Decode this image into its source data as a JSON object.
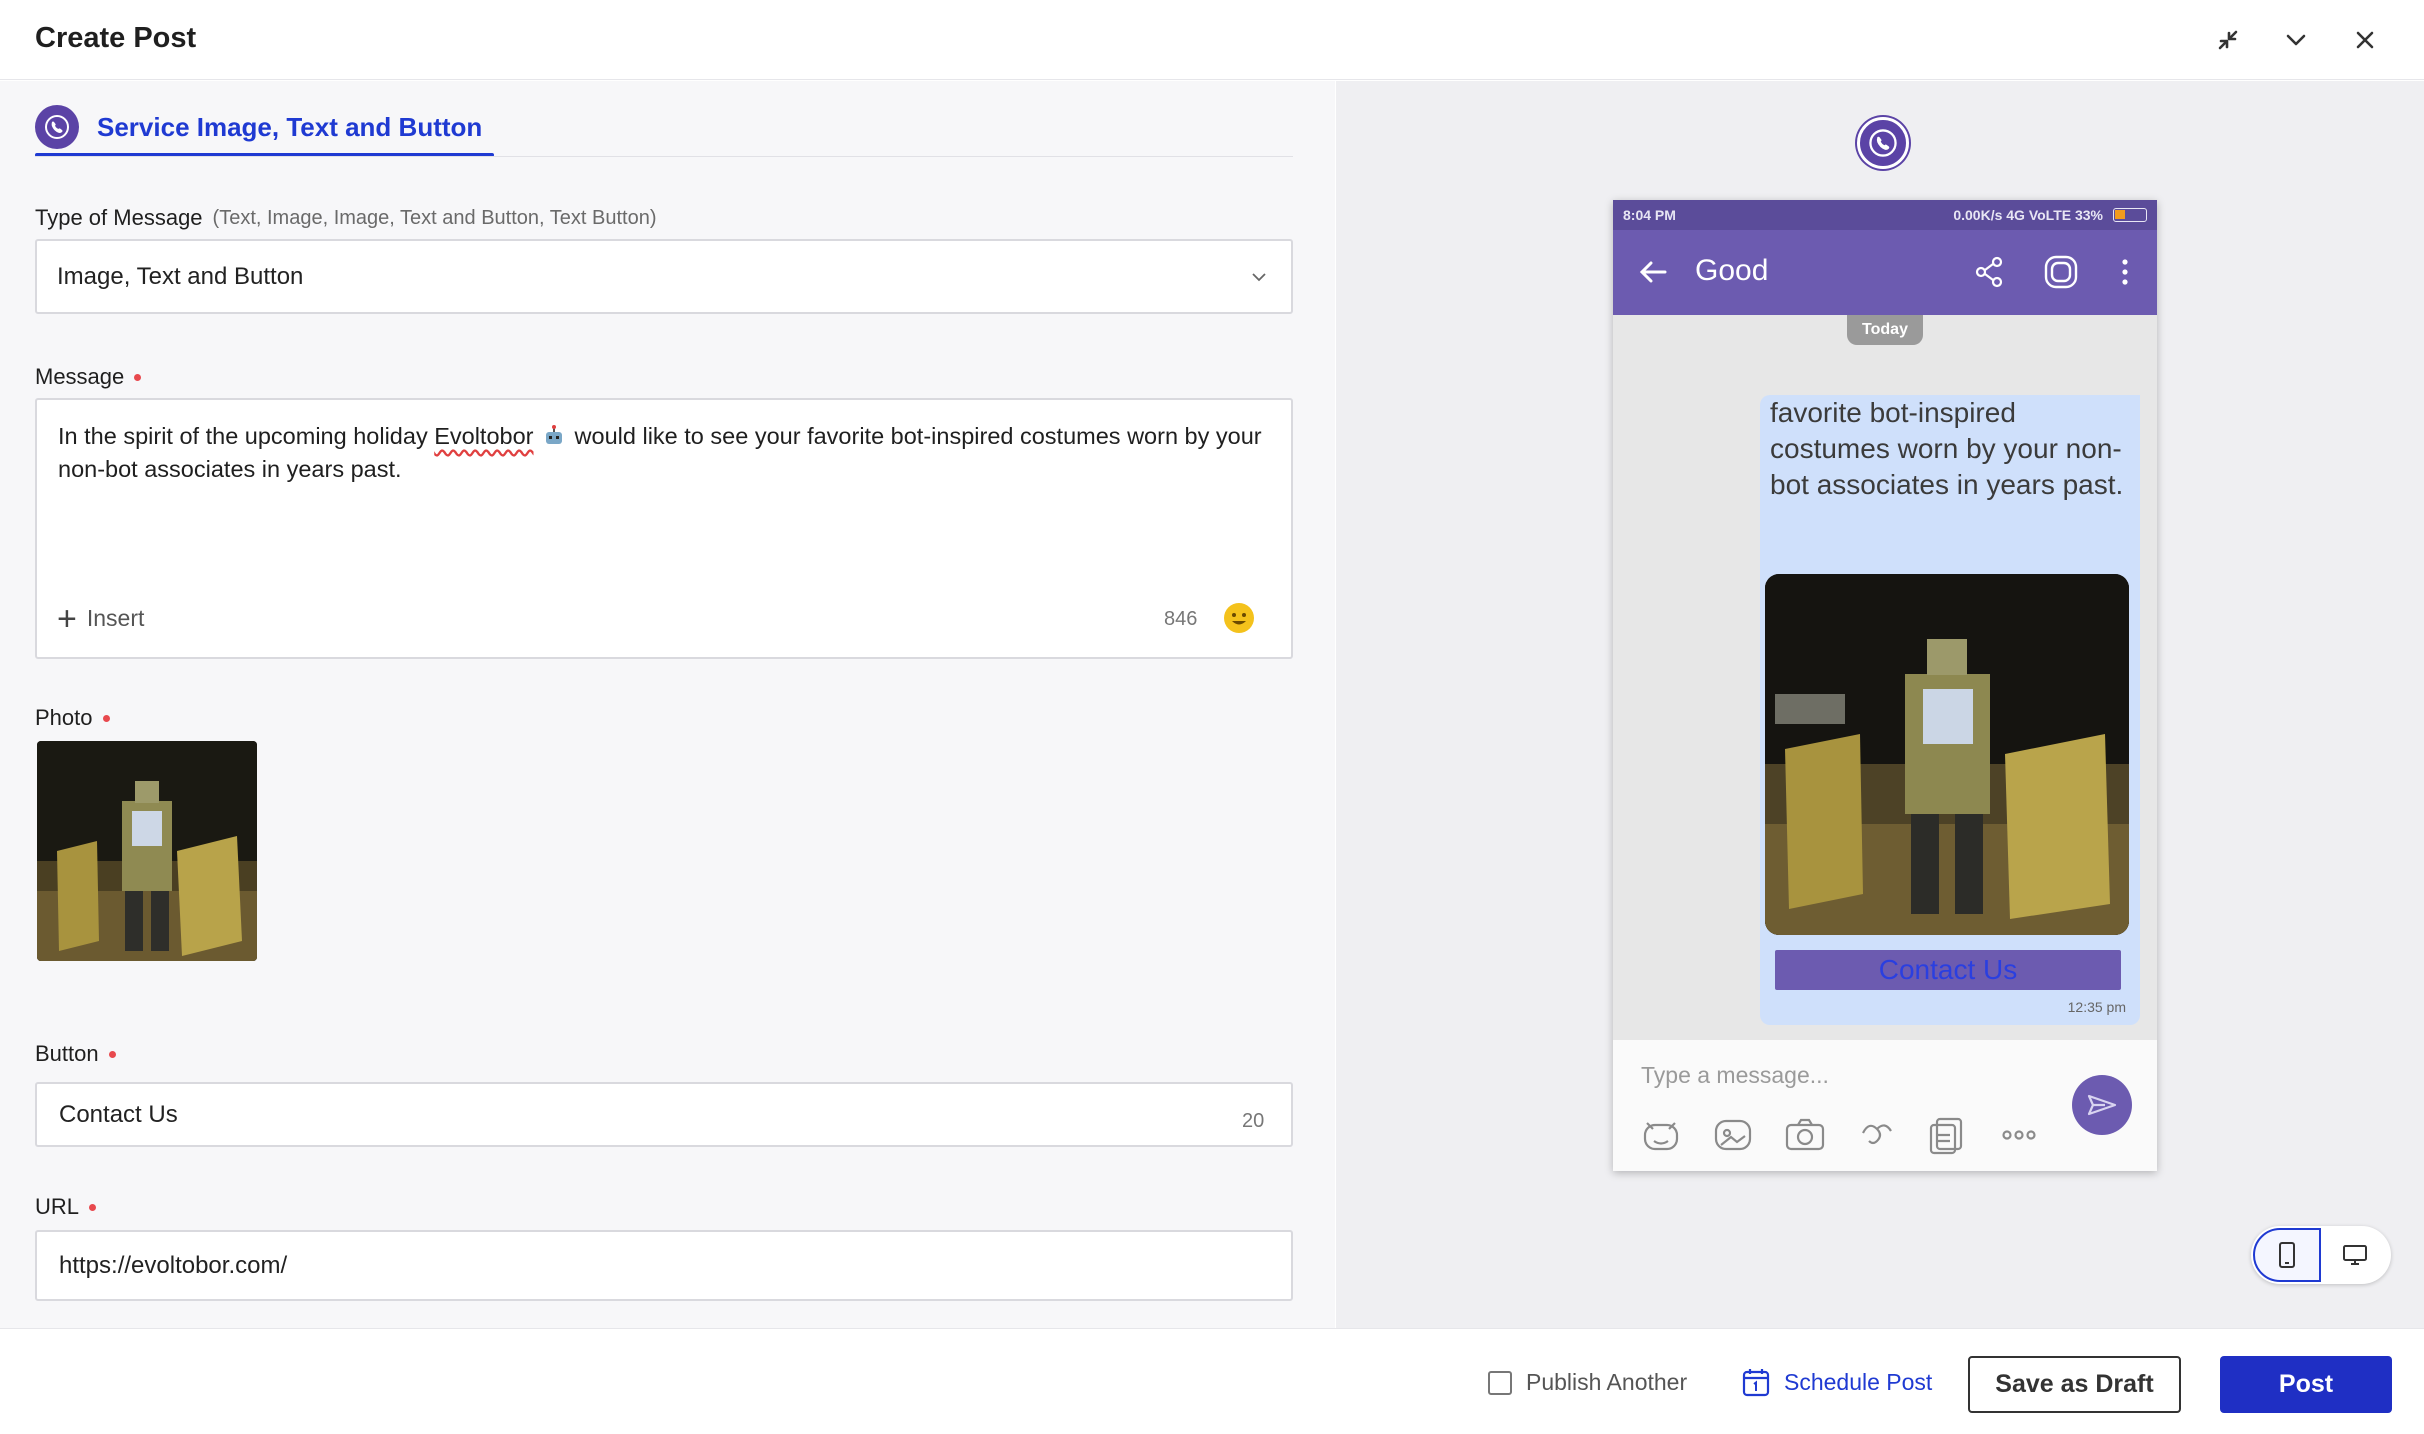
{
  "header": {
    "title": "Create Post"
  },
  "tab": {
    "label": "Service Image, Text and Button"
  },
  "type_of_message": {
    "label": "Type of Message",
    "hint": "(Text, Image, Image, Text and Button, Text Button)",
    "value": "Image, Text and Button"
  },
  "message": {
    "label": "Message",
    "text_before": "In the spirit of the upcoming holiday ",
    "text_brand": "Evoltobor",
    "text_after": " would like to see your favorite bot-inspired costumes worn by your non-bot associates in years past.",
    "insert_label": "Insert",
    "char_count": "846"
  },
  "photo": {
    "label": "Photo"
  },
  "button": {
    "label": "Button",
    "value": "Contact Us",
    "char_count": "20"
  },
  "url": {
    "label": "URL",
    "value": "https://evoltobor.com/"
  },
  "preview": {
    "status_time": "8:04 PM",
    "status_right": "0.00K/s   4G VoLTE   33%",
    "chat_title": "Good",
    "today": "Today",
    "bubble_text": "favorite bot-inspired costumes worn by your non-bot associates in years past.",
    "bubble_button": "Contact Us",
    "bubble_time": "12:35 pm",
    "input_placeholder": "Type a message..."
  },
  "footer": {
    "publish_another": "Publish Another",
    "schedule_post": "Schedule Post",
    "save_draft": "Save as Draft",
    "post": "Post"
  },
  "colors": {
    "accent": "#1f3ad2",
    "viber": "#5b43a6",
    "required": "#e8494e"
  }
}
